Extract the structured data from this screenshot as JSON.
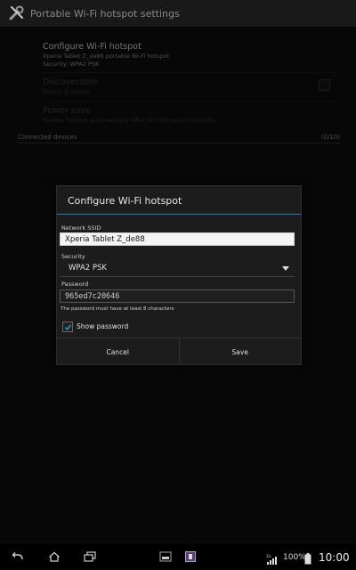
{
  "actionbar": {
    "title": "Portable Wi-Fi hotspot settings",
    "icon": "wrench-screwdriver-icon"
  },
  "settings": {
    "configure": {
      "title": "Configure Wi-Fi hotspot",
      "line1": "Xperia Tablet Z_de88 portable Wi-Fi hotspot",
      "line2": "Security: WPA2 PSK"
    },
    "discoverable": {
      "title": "Discoverable",
      "subtitle": "Device is visible"
    },
    "power_save": {
      "title": "Power save",
      "subtitle": "Disable hotspot automatically after 10 minutes of inactivity"
    },
    "connected": {
      "label": "Connected devices",
      "count": "(0/10)"
    }
  },
  "dialog": {
    "title": "Configure Wi-Fi hotspot",
    "ssid_label": "Network SSID",
    "ssid_value": "Xperia Tablet Z_de88",
    "security_label": "Security",
    "security_value": "WPA2 PSK",
    "password_label": "Password",
    "password_value": "965ed7c20646",
    "password_hint": "The password must have at least 8 characters",
    "show_password_label": "Show password",
    "show_password_checked": true,
    "cancel_label": "Cancel",
    "save_label": "Save"
  },
  "statusbar": {
    "network": "3G",
    "battery": "100%",
    "time": "10:00"
  },
  "colors": {
    "accent": "#1f7fb0",
    "background": "#0b0b0b"
  }
}
